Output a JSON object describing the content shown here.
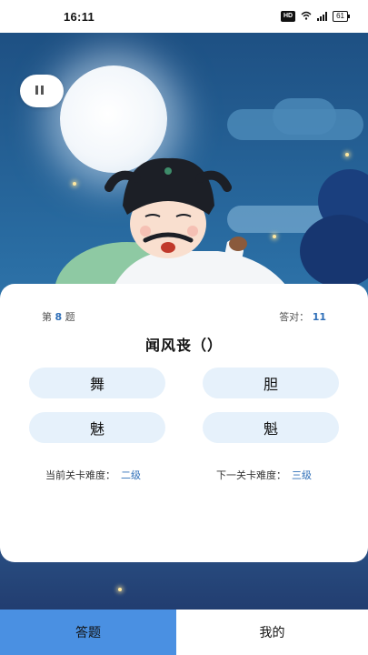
{
  "status_bar": {
    "time": "16:11",
    "hd": "HD",
    "battery": "61"
  },
  "quiz": {
    "question_prefix": "第",
    "question_number": "8",
    "question_suffix": "题",
    "correct_label": "答对：",
    "correct_count": "11",
    "question_text": "闻风丧（）",
    "options": [
      "舞",
      "胆",
      "魅",
      "魁"
    ],
    "current_difficulty_label": "当前关卡难度：",
    "current_difficulty": "二级",
    "next_difficulty_label": "下一关卡难度：",
    "next_difficulty": "三级"
  },
  "tabs": [
    {
      "label": "答题"
    },
    {
      "label": "我的"
    }
  ],
  "colors": {
    "accent": "#2f6fb8",
    "tab_active_bg": "#4a90e2",
    "option_bg": "#e6f1fb"
  },
  "icons": {
    "music_toggle": "music-play-icon"
  }
}
